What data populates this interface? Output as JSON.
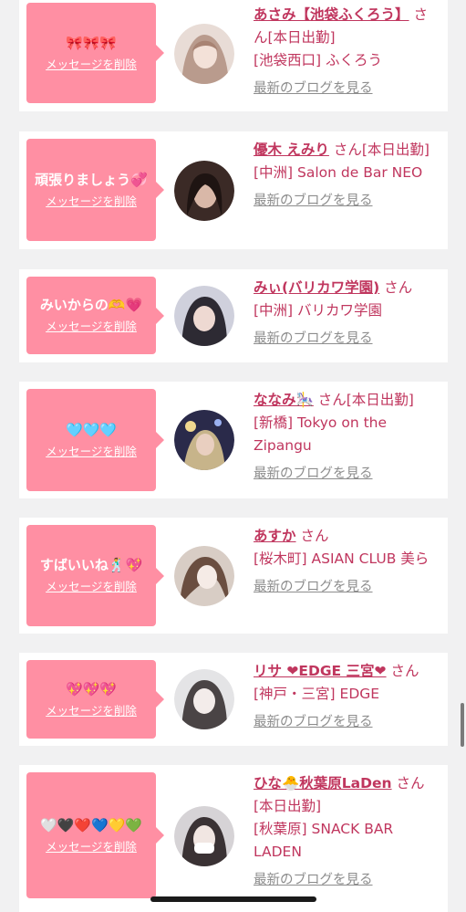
{
  "delete_label": "メッセージを削除",
  "blog_label": "最新のブログを見る",
  "colors": {
    "bubble": "#ff8fa3",
    "accent": "#c0365e",
    "muted": "#8d8d8d",
    "background": "#f1f1f2"
  },
  "cards": [
    {
      "message": "🎀🎀🎀",
      "name": "あさみ【池袋ふくろう】",
      "suffix": "さん[本日出勤]",
      "shop": "[池袋西口] ふくろう"
    },
    {
      "message": "頑張りましょう💞",
      "name": "優木 えみり",
      "suffix": "さん[本日出勤]",
      "shop": "[中洲] Salon de Bar NEO"
    },
    {
      "message": "みいからの🫶💗",
      "name": "みぃ(バリカワ学園)",
      "suffix": "さん",
      "shop": "[中洲] バリカワ学園"
    },
    {
      "message": "🩵🩵🩵",
      "name": "ななみ🎠",
      "suffix": "さん[本日出勤]",
      "shop": "[新橋] Tokyo on the Zipangu"
    },
    {
      "message": "すばいいね🕺💖",
      "name": "あすか",
      "suffix": "さん",
      "shop": "[桜木町] ASIAN CLUB 美ら"
    },
    {
      "message": "💖💖💖",
      "name": "リサ ❤EDGE 三宮❤",
      "suffix": "さん",
      "shop": "[神戸・三宮] EDGE"
    },
    {
      "message": "🤍🖤❤️💙💛💚",
      "name": "ひな🐣秋葉原LaDen",
      "suffix": "さん[本日出勤]",
      "shop": "[秋葉原] SNACK BAR LADEN"
    }
  ]
}
